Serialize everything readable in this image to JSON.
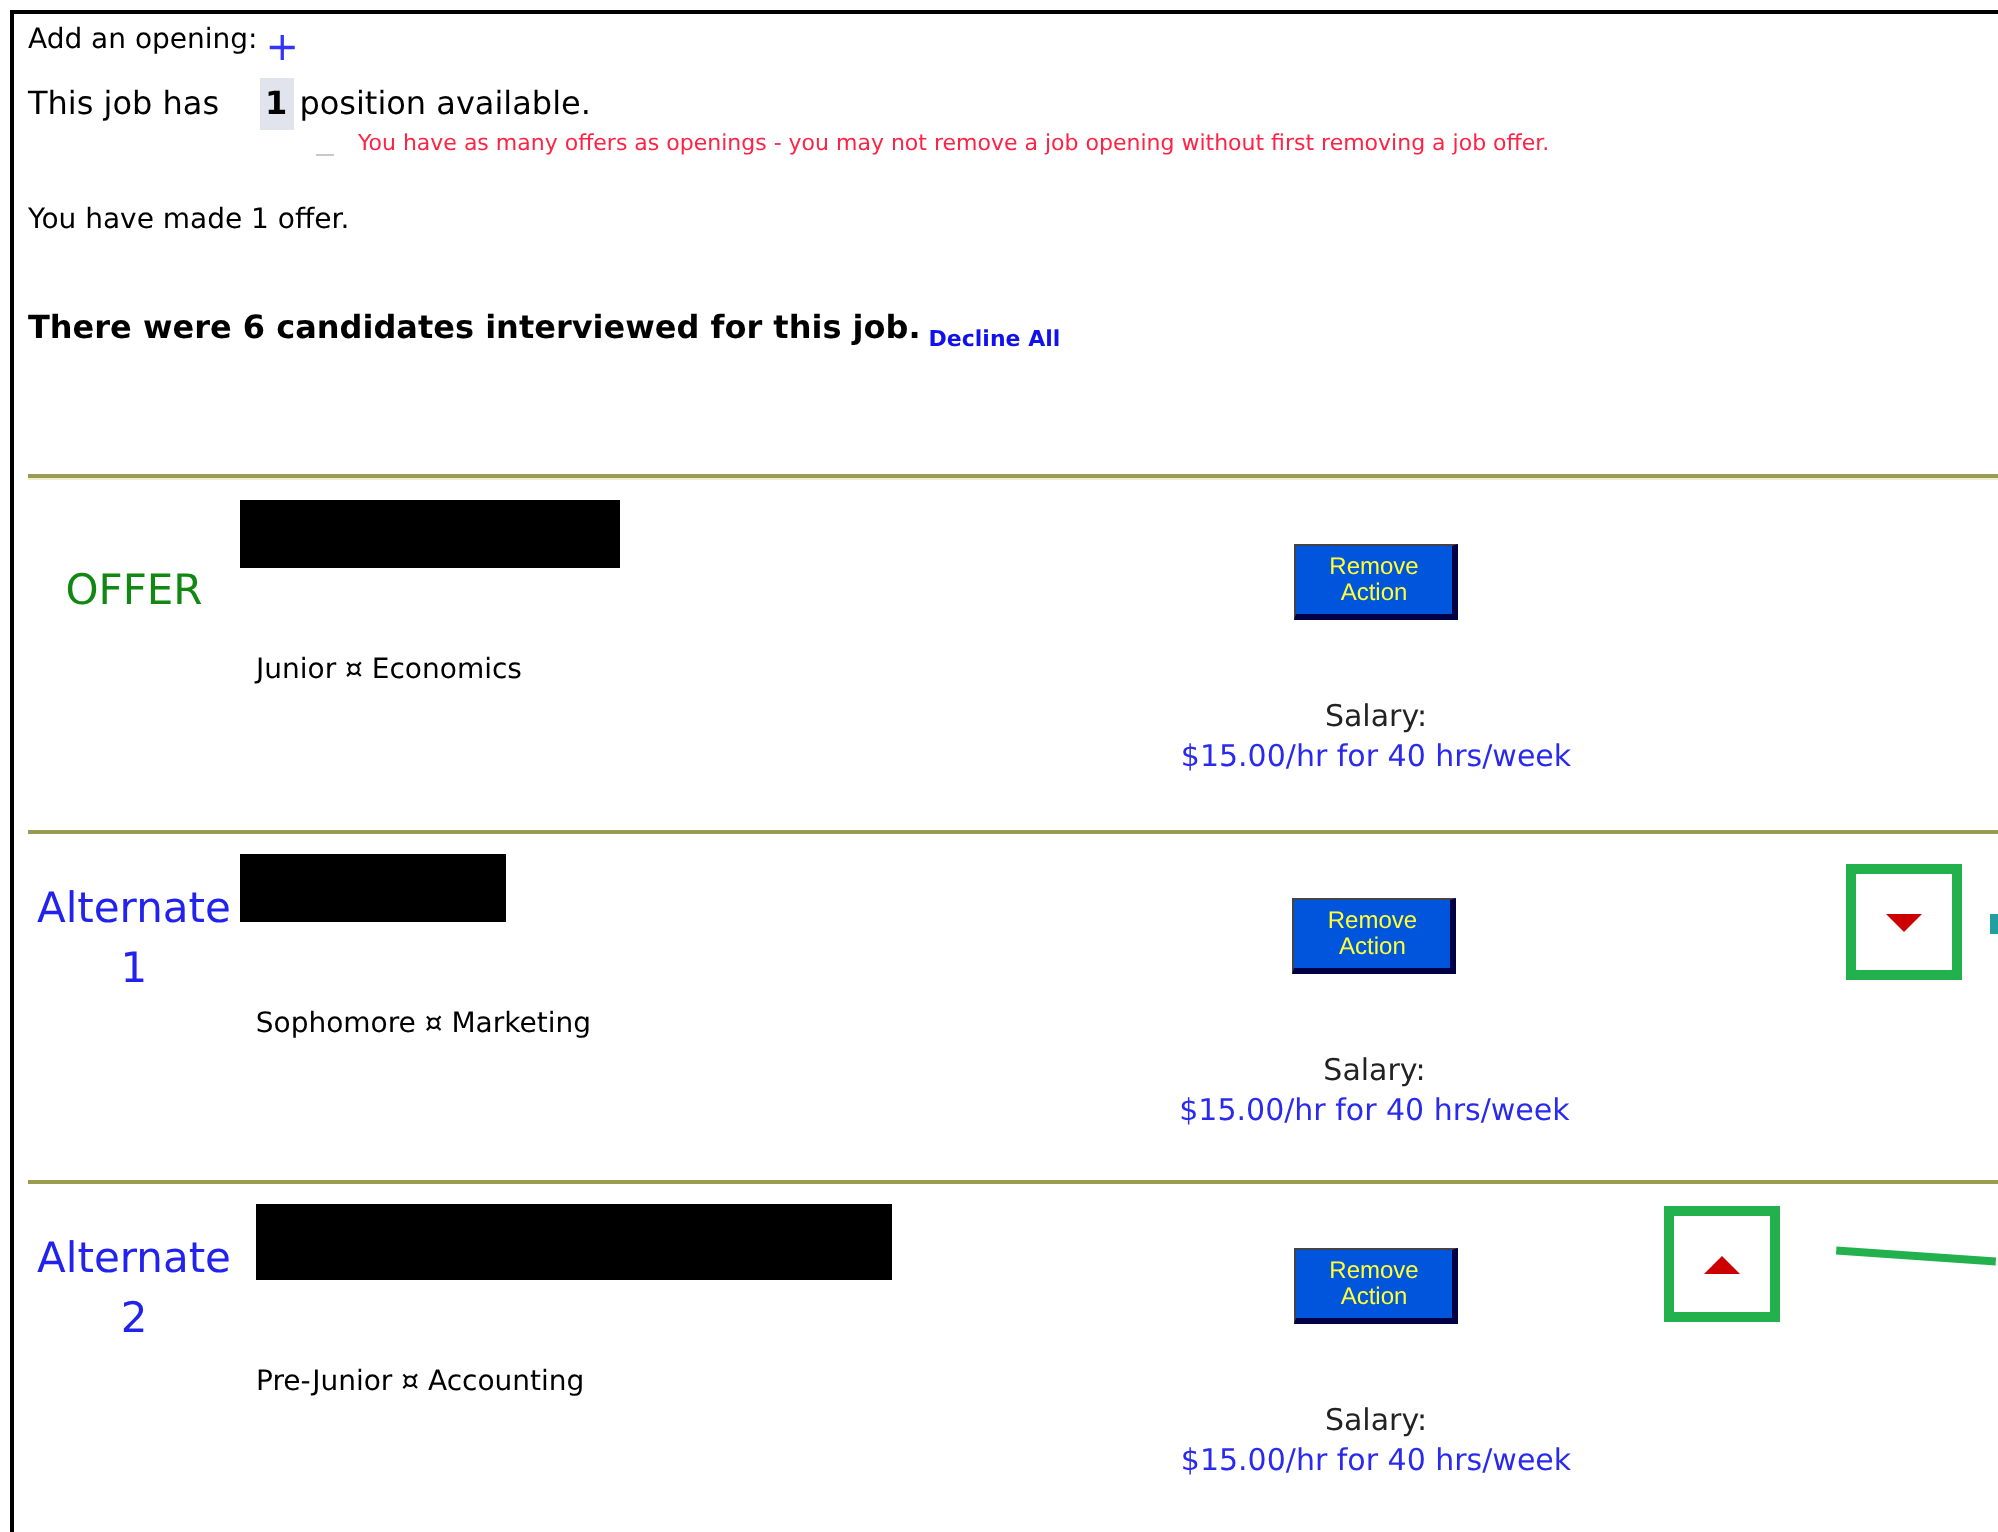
{
  "add_opening": {
    "label": "Add an opening:",
    "icon_text": "+"
  },
  "positions": {
    "prefix": "This job has",
    "count": "1",
    "suffix": "position available.",
    "remove_disabled": true,
    "warning": "You have as many offers as openings - you may not remove a job opening without first removing a job offer."
  },
  "offers_made": "You have made 1 offer.",
  "interviewed": {
    "heading": "There were 6 candidates interviewed for this job.",
    "decline_all": "Decline All"
  },
  "candidates": [
    {
      "kind": "offer",
      "label": "OFFER",
      "name_redacted": true,
      "details": "Junior ¤ Economics",
      "button": "Remove Action",
      "salary_label": "Salary:",
      "salary": "$15.00/hr for 40 hrs/week"
    },
    {
      "kind": "alternate",
      "label": "Alternate",
      "rank": "1",
      "name_redacted": true,
      "details": "Sophomore ¤ Marketing",
      "button": "Remove Action",
      "salary_label": "Salary:",
      "salary": "$15.00/hr for 40 hrs/week",
      "move_arrow": {
        "kind": "down",
        "highlighted": true
      }
    },
    {
      "kind": "alternate",
      "label": "Alternate",
      "rank": "2",
      "name_redacted": true,
      "details": "Pre-Junior ¤ Accounting",
      "button": "Remove Action",
      "salary_label": "Salary:",
      "salary": "$15.00/hr for 40 hrs/week",
      "move_arrow": {
        "kind": "up",
        "highlighted": true
      }
    }
  ]
}
